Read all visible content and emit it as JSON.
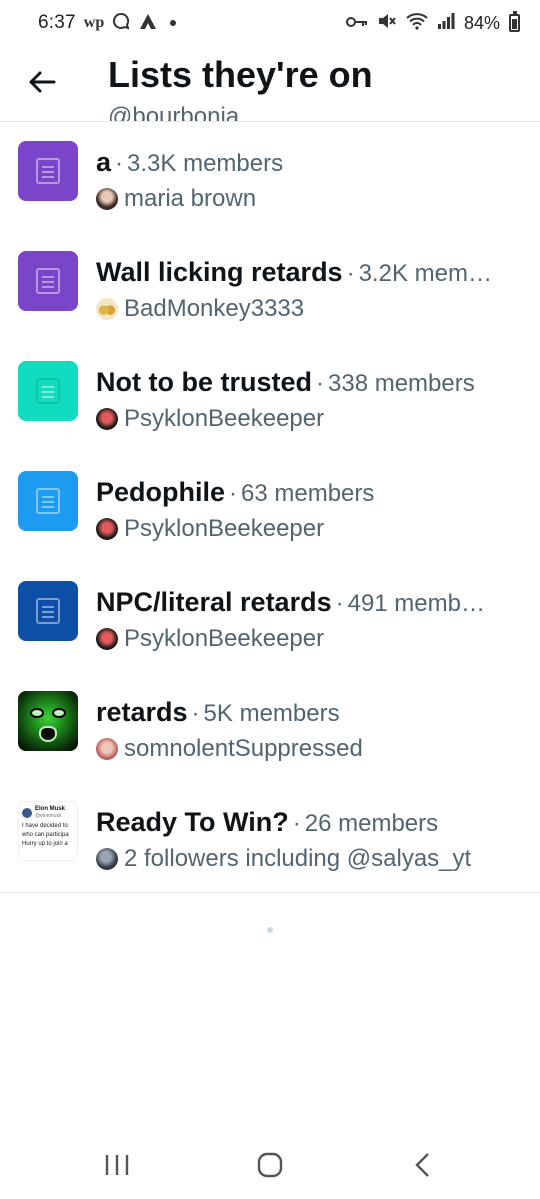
{
  "status_bar": {
    "time": "6:37",
    "left_icons": [
      "wp",
      "chat-icon",
      "arch-icon"
    ],
    "battery": "84%"
  },
  "header": {
    "title": "Lists they're on",
    "subtitle": "@bourbonia"
  },
  "lists": [
    {
      "name": "a",
      "members": "3.3K members",
      "owner": "maria brown",
      "color": "#7b45c9",
      "owner_color": "#6b4a3a"
    },
    {
      "name": "Wall licking retards",
      "members": "3.2K mem…",
      "owner": "BadMonkey3333",
      "color": "#7b45c9",
      "owner_color": "#caa34a"
    },
    {
      "name": "Not to be trusted",
      "members": "338 members",
      "owner": "PsyklonBeekeeper",
      "color": "#12dcc0",
      "owner_color": "#c4303a"
    },
    {
      "name": "Pedophile",
      "members": "63 members",
      "owner": "PsyklonBeekeeper",
      "color": "#1d9bf0",
      "owner_color": "#c4303a"
    },
    {
      "name": "NPC/literal retards",
      "members": "491 memb…",
      "owner": "PsyklonBeekeeper",
      "color": "#0d4fa6",
      "owner_color": "#c4303a"
    },
    {
      "name": "retards",
      "members": "5K members",
      "owner": "somnolentSuppressed",
      "color": "#1f8a1c",
      "owner_color": "#b85c5c"
    },
    {
      "name": "Ready To Win?",
      "members": "26 members",
      "owner": "2 followers including @salyas_yt",
      "color": "#ffffff",
      "owner_color": "#4a5566"
    }
  ],
  "tweet_thumb": {
    "name": "Elon Musk",
    "handle": "@elonmusk",
    "lines": [
      "I have decided to",
      "who can participa",
      "Hurry up to join a"
    ]
  },
  "separator": "·"
}
